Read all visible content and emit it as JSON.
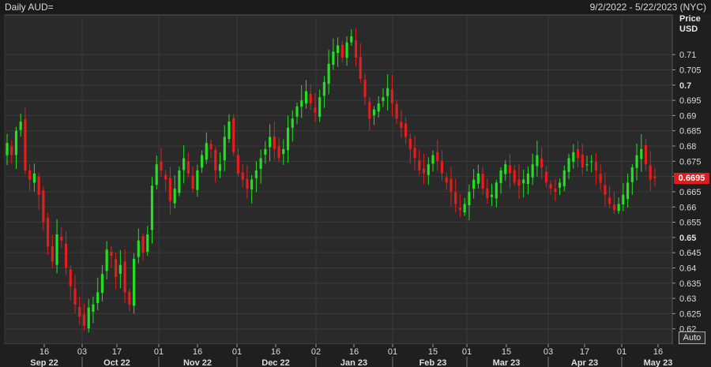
{
  "header": {
    "title": "Daily AUD=",
    "date_range": "9/2/2022 - 5/22/2023 (NYC)"
  },
  "price_axis": {
    "title_line1": "Price",
    "title_line2": "USD",
    "last_price": "0.6695"
  },
  "controls": {
    "auto_label": "Auto"
  },
  "colors": {
    "up": "#22e022",
    "down": "#e51d1d",
    "background": "#2a2a2a",
    "grid": "#3a3a3a",
    "last_price_badge": "#e01b1b"
  },
  "chart_data": {
    "type": "candlestick",
    "title": "Daily AUD=",
    "ylabel": "Price USD",
    "ylim": [
      0.615,
      0.723
    ],
    "y_ticks": [
      0.62,
      0.625,
      0.63,
      0.635,
      0.64,
      0.645,
      0.65,
      0.655,
      0.66,
      0.665,
      0.67,
      0.675,
      0.68,
      0.685,
      0.69,
      0.695,
      0.7,
      0.705,
      0.71
    ],
    "y_ticks_bold": [
      0.65,
      0.7
    ],
    "x_ticks": [
      {
        "day": "16",
        "month": "Sep 22"
      },
      {
        "day": "03",
        "month": ""
      },
      {
        "day": "17",
        "month": "Oct 22"
      },
      {
        "day": "01",
        "month": ""
      },
      {
        "day": "16",
        "month": "Nov 22"
      },
      {
        "day": "01",
        "month": ""
      },
      {
        "day": "16",
        "month": "Dec 22"
      },
      {
        "day": "02",
        "month": ""
      },
      {
        "day": "16",
        "month": "Jan 23"
      },
      {
        "day": "01",
        "month": ""
      },
      {
        "day": "15",
        "month": "Feb 23"
      },
      {
        "day": "01",
        "month": ""
      },
      {
        "day": "15",
        "month": "Mar 23"
      },
      {
        "day": "03",
        "month": ""
      },
      {
        "day": "17",
        "month": "Apr 23"
      },
      {
        "day": "01",
        "month": ""
      },
      {
        "day": "16",
        "month": "May 23"
      }
    ],
    "close_path": [
      0.681,
      0.677,
      0.685,
      0.688,
      0.672,
      0.669,
      0.671,
      0.664,
      0.655,
      0.647,
      0.642,
      0.651,
      0.649,
      0.64,
      0.634,
      0.628,
      0.624,
      0.621,
      0.627,
      0.628,
      0.632,
      0.638,
      0.646,
      0.644,
      0.637,
      0.641,
      0.632,
      0.628,
      0.643,
      0.649,
      0.645,
      0.651,
      0.667,
      0.674,
      0.672,
      0.669,
      0.662,
      0.666,
      0.672,
      0.676,
      0.671,
      0.666,
      0.672,
      0.677,
      0.681,
      0.679,
      0.672,
      0.674,
      0.683,
      0.688,
      0.678,
      0.671,
      0.669,
      0.666,
      0.669,
      0.672,
      0.676,
      0.679,
      0.683,
      0.679,
      0.676,
      0.679,
      0.686,
      0.689,
      0.693,
      0.695,
      0.698,
      0.694,
      0.691,
      0.696,
      0.701,
      0.707,
      0.711,
      0.713,
      0.709,
      0.714,
      0.716,
      0.709,
      0.702,
      0.696,
      0.689,
      0.692,
      0.694,
      0.696,
      0.699,
      0.694,
      0.689,
      0.686,
      0.683,
      0.679,
      0.676,
      0.672,
      0.671,
      0.674,
      0.677,
      0.675,
      0.671,
      0.668,
      0.665,
      0.661,
      0.659,
      0.661,
      0.665,
      0.669,
      0.671,
      0.666,
      0.663,
      0.664,
      0.668,
      0.672,
      0.674,
      0.671,
      0.668,
      0.667,
      0.669,
      0.671,
      0.674,
      0.677,
      0.673,
      0.668,
      0.666,
      0.665,
      0.668,
      0.672,
      0.676,
      0.678,
      0.676,
      0.673,
      0.674,
      0.675,
      0.672,
      0.668,
      0.664,
      0.661,
      0.659,
      0.661,
      0.664,
      0.668,
      0.673,
      0.677,
      0.679,
      0.674,
      0.669,
      0.6695
    ]
  }
}
